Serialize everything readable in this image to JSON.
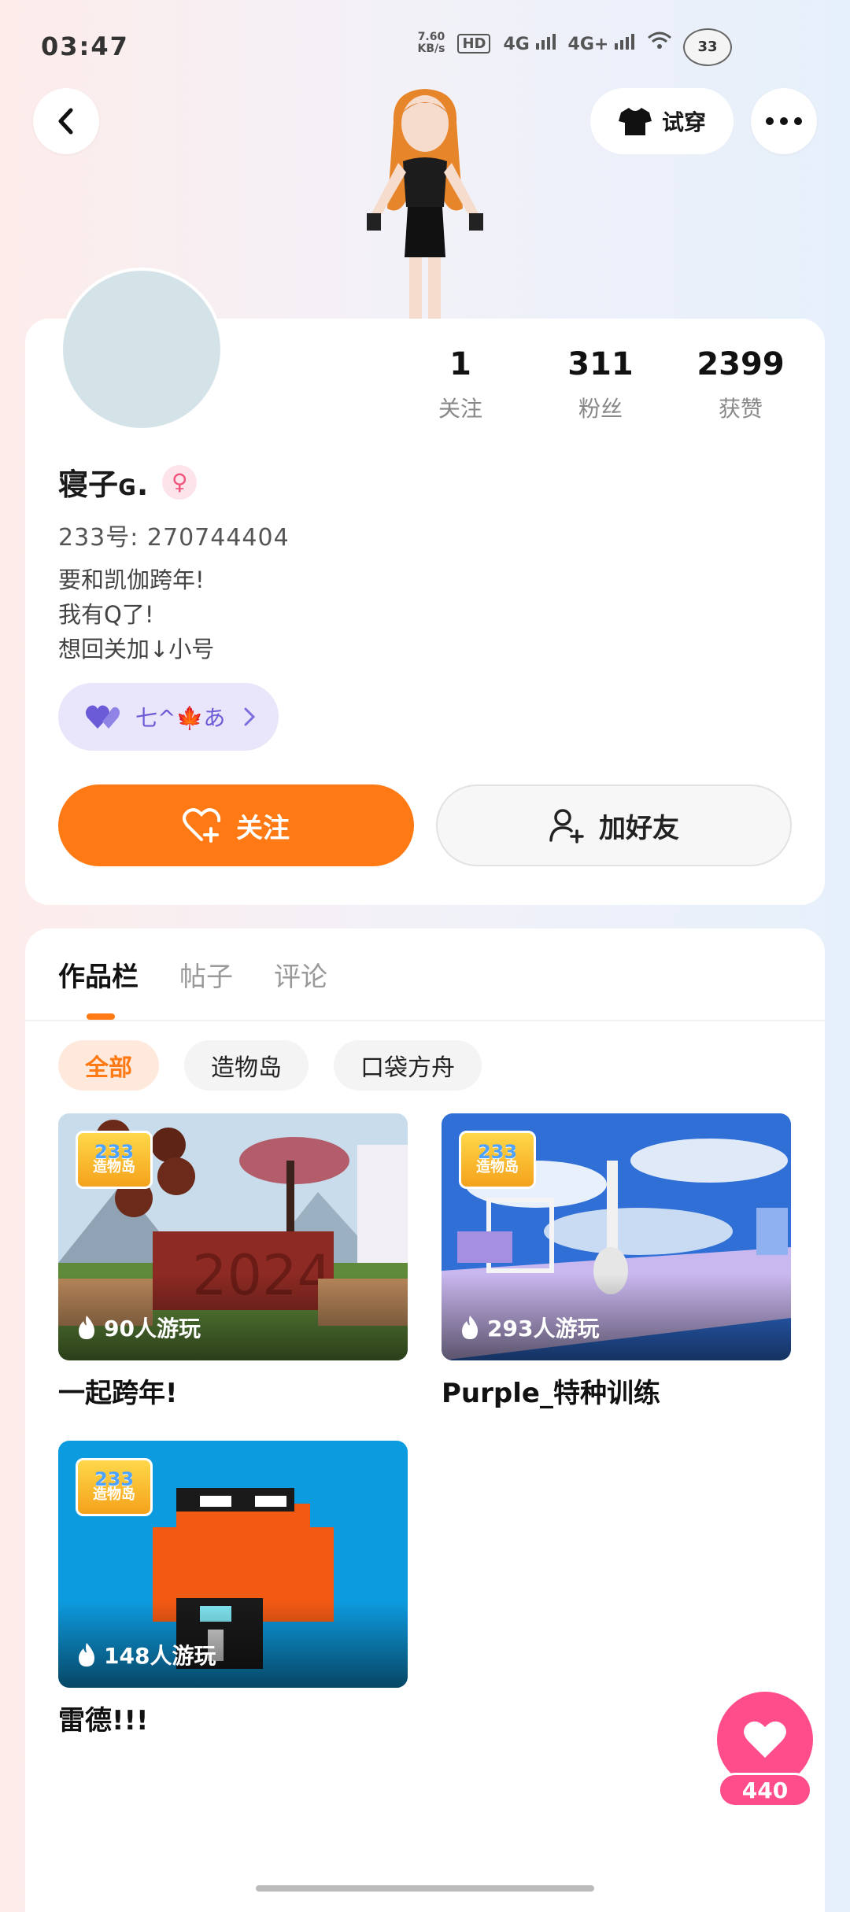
{
  "status_bar": {
    "time": "03:47",
    "net_speed_value": "7.60",
    "net_speed_unit": "KB/s",
    "hd_label": "HD",
    "net1": "4G",
    "net2": "4G+",
    "kitty_label": "33"
  },
  "header": {
    "tryon_label": "试穿"
  },
  "profile": {
    "stats": [
      {
        "value": "1",
        "label": "关注"
      },
      {
        "value": "311",
        "label": "粉丝"
      },
      {
        "value": "2399",
        "label": "获赞"
      }
    ],
    "name": "寝子ɢ.",
    "gender_symbol": "♀",
    "id_text": "233号: 270744404",
    "bio": [
      "要和凯伽跨年!",
      "我有Q了!",
      "想回关加↓小号"
    ],
    "couple_label": "七^🍁あ",
    "follow_label": "关注",
    "add_friend_label": "加好友"
  },
  "works": {
    "tabs": [
      "作品栏",
      "帖子",
      "评论"
    ],
    "active_tab": 0,
    "filters": [
      "全部",
      "造物岛",
      "口袋方舟"
    ],
    "badge": {
      "line1": "233",
      "line2": "造物岛"
    },
    "items": [
      {
        "plays": "90人游玩",
        "title": "一起跨年!"
      },
      {
        "plays": "293人游玩",
        "title": "Purple_特种训练"
      },
      {
        "plays": "148人游玩",
        "title": "雷德!!!"
      }
    ]
  },
  "like_fab": {
    "count": "440"
  },
  "colors": {
    "accent": "#ff7a14",
    "like": "#fe4d8a",
    "couple": "#6b5bd6"
  }
}
